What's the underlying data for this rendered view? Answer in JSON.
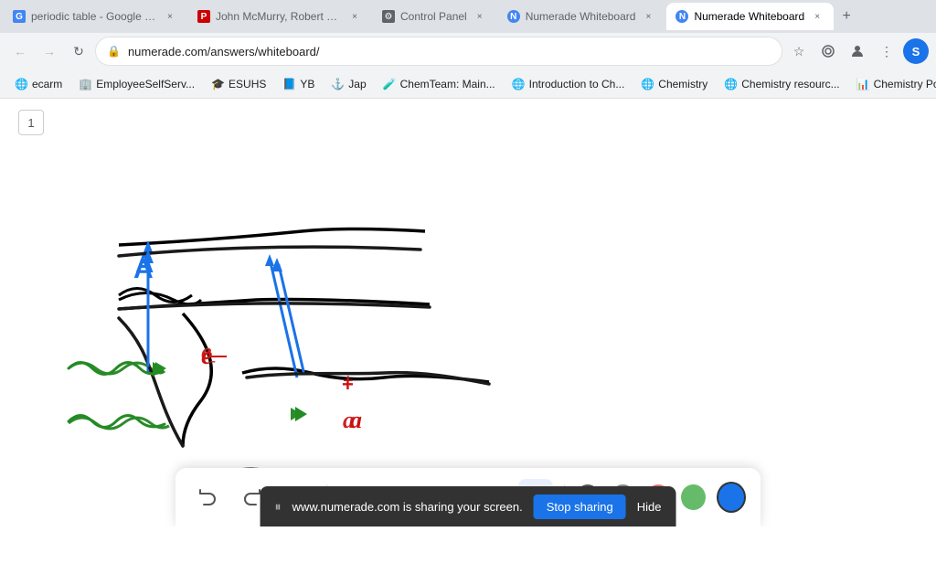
{
  "browser": {
    "tabs": [
      {
        "id": "tab1",
        "title": "periodic table - Google Search",
        "favicon_color": "#4285f4",
        "favicon_letter": "G",
        "active": false
      },
      {
        "id": "tab2",
        "title": "John McMurry, Robert C. Fay...",
        "favicon_color": "#cc0000",
        "favicon_letter": "P",
        "active": false
      },
      {
        "id": "tab3",
        "title": "Control Panel",
        "favicon_color": "#5f6368",
        "favicon_letter": "C",
        "active": false
      },
      {
        "id": "tab4",
        "title": "Numerade Whiteboard",
        "favicon_color": "#4285f4",
        "favicon_letter": "N",
        "active": false
      },
      {
        "id": "tab5",
        "title": "Numerade Whiteboard",
        "favicon_color": "#4285f4",
        "favicon_letter": "N",
        "active": true
      }
    ],
    "url": "numerade.com/answers/whiteboard/",
    "bookmarks": [
      {
        "label": "ecarm",
        "favicon_color": "#5f6368"
      },
      {
        "label": "EmployeeSelfServ...",
        "favicon_color": "#0078d4"
      },
      {
        "label": "ESUHS",
        "favicon_color": "#2e7d32"
      },
      {
        "label": "YB",
        "favicon_color": "#4285f4"
      },
      {
        "label": "Jap",
        "favicon_color": "#5f6368"
      },
      {
        "label": "ChemTeam: Main...",
        "favicon_color": "#ff6d00"
      },
      {
        "label": "Introduction to Ch...",
        "favicon_color": "#4285f4"
      },
      {
        "label": "Chemistry",
        "favicon_color": "#4285f4"
      },
      {
        "label": "Chemistry resourc...",
        "favicon_color": "#673ab7"
      },
      {
        "label": "Chemistry PowerP...",
        "favicon_color": "#1565c0"
      }
    ]
  },
  "page": {
    "number": "1",
    "url_display": "numerade.com/answers/whiteboard/"
  },
  "toolbar": {
    "undo_label": "↺",
    "redo_label": "↻",
    "select_label": "↖",
    "pen_label": "✏",
    "triangle_label": "▲",
    "plus_label": "+",
    "shape_label": "⬭",
    "frame_label": "⬜",
    "colors": [
      "#888888",
      "#888888",
      "#cc4444",
      "#44aa44",
      "#1a73e8"
    ],
    "color_labels": [
      "gray",
      "gray2",
      "red",
      "green",
      "blue"
    ]
  },
  "screenshare": {
    "message": "www.numerade.com is sharing your screen.",
    "stop_label": "Stop sharing",
    "hide_label": "Hide"
  }
}
